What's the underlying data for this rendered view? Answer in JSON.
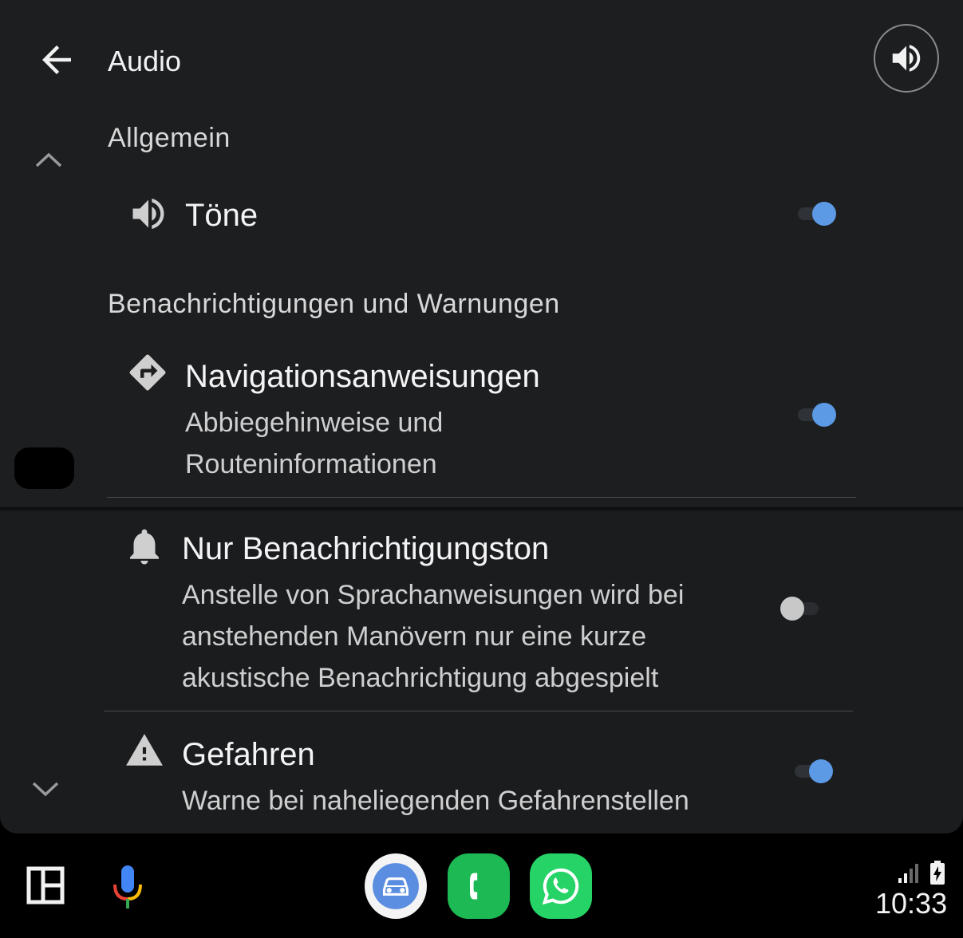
{
  "header": {
    "title": "Audio"
  },
  "sections": {
    "general": {
      "title": "Allgemein",
      "tones": {
        "title": "Töne",
        "enabled": true
      }
    },
    "notifications": {
      "title": "Benachrichtigungen und Warnungen",
      "navigation": {
        "title": "Navigationsanweisungen",
        "subtitle_line1": "Abbiegehinweise und",
        "subtitle_line2": "Routeninformationen",
        "enabled": true
      },
      "notify_only": {
        "title": "Nur Benachrichtigungston",
        "subtitle_line1": "Anstelle von Sprachanweisungen wird bei",
        "subtitle_line2": "anstehenden Manövern nur eine kurze",
        "subtitle_line3": "akustische Benachrichtigung abgespielt",
        "enabled": false
      },
      "hazards": {
        "title": "Gefahren",
        "subtitle": "Warne bei naheliegenden Gefahrenstellen",
        "enabled": true
      }
    }
  },
  "taskbar": {
    "icons": [
      "dashboard-icon",
      "microphone-icon",
      "car-app-icon",
      "phone-app-icon",
      "whatsapp-icon",
      "signal-icon",
      "battery-charging-icon"
    ],
    "time": "10:33"
  },
  "colors": {
    "accent": "#5c9ae6",
    "background": "#1d1e20",
    "phone_app": "#1db954",
    "whatsapp": "#25d366"
  }
}
